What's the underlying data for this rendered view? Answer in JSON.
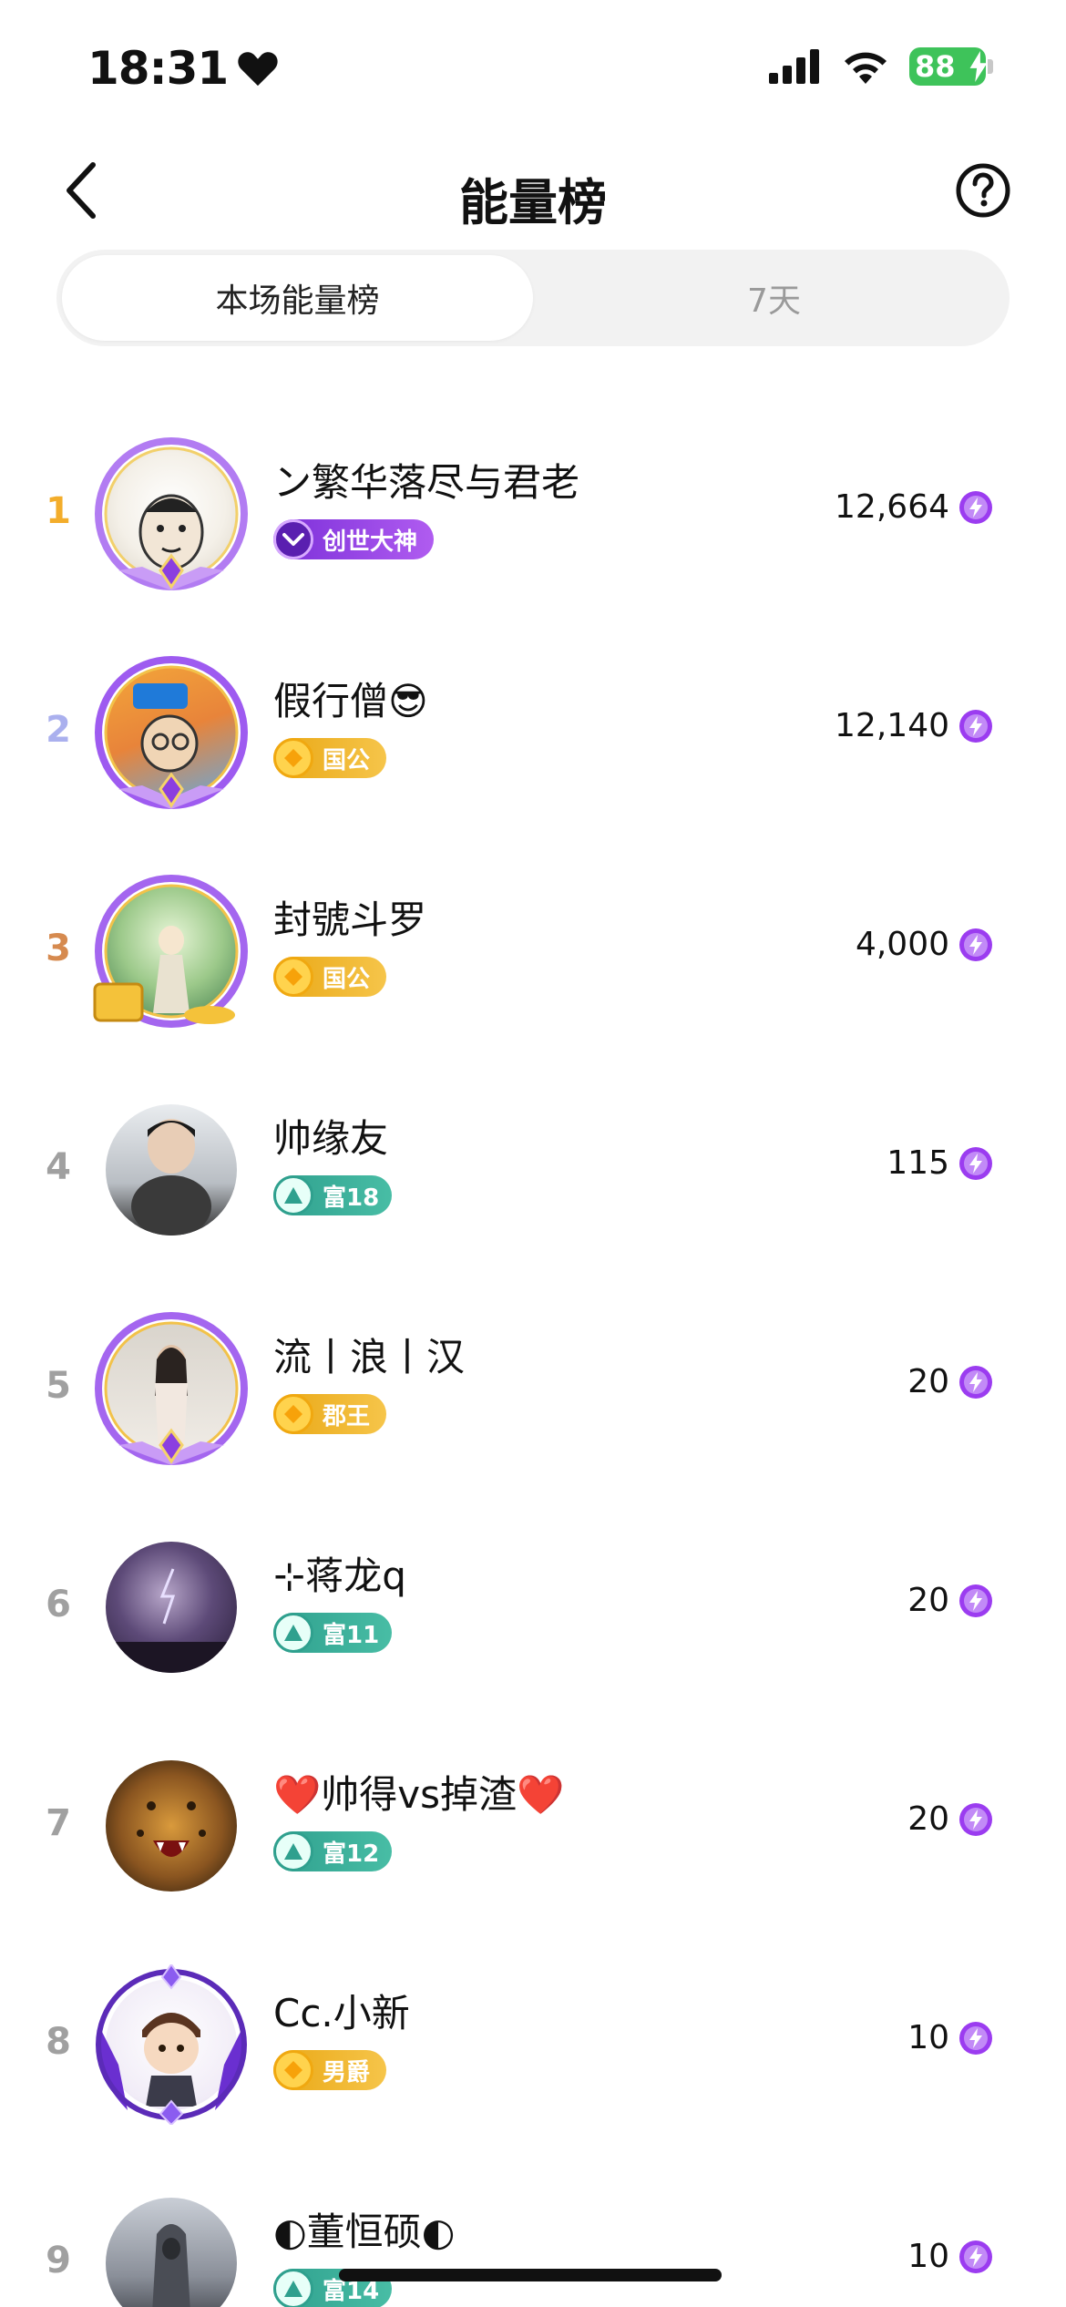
{
  "status_bar": {
    "time": "18:31",
    "battery": "88"
  },
  "header": {
    "title": "能量榜"
  },
  "tabs": [
    {
      "label": "本场能量榜",
      "active": true
    },
    {
      "label": "7天",
      "active": false
    }
  ],
  "colors": {
    "energy_accent": "#9b3cf0",
    "gold_rank": "#f3ad2b",
    "silver_rank": "#aab0ee",
    "bronze_rank": "#d68a4f"
  },
  "rows": [
    {
      "rank": "1",
      "name": "ン繁华落尽与君老",
      "badge": "创世大神",
      "badge_type": "purple",
      "score": "12,664"
    },
    {
      "rank": "2",
      "name": "假行僧😎",
      "badge": "国公",
      "badge_type": "gold",
      "score": "12,140"
    },
    {
      "rank": "3",
      "name": "封號斗罗",
      "badge": "国公",
      "badge_type": "gold",
      "score": "4,000"
    },
    {
      "rank": "4",
      "name": "帅缘友",
      "badge": "富18",
      "badge_type": "teal",
      "score": "115"
    },
    {
      "rank": "5",
      "name": "流丨浪丨汉",
      "badge": "郡王",
      "badge_type": "gold",
      "score": "20"
    },
    {
      "rank": "6",
      "name": "⊹蒋龙q",
      "badge": "富11",
      "badge_type": "teal",
      "score": "20"
    },
    {
      "rank": "7",
      "name": "❤️帅得vs掉渣❤️",
      "badge": "富12",
      "badge_type": "teal",
      "score": "20"
    },
    {
      "rank": "8",
      "name": "Cc.小新",
      "badge": "男爵",
      "badge_type": "gold",
      "score": "10"
    },
    {
      "rank": "9",
      "name": "◐董恒硕◐",
      "badge": "富14",
      "badge_type": "teal",
      "score": "10"
    }
  ]
}
